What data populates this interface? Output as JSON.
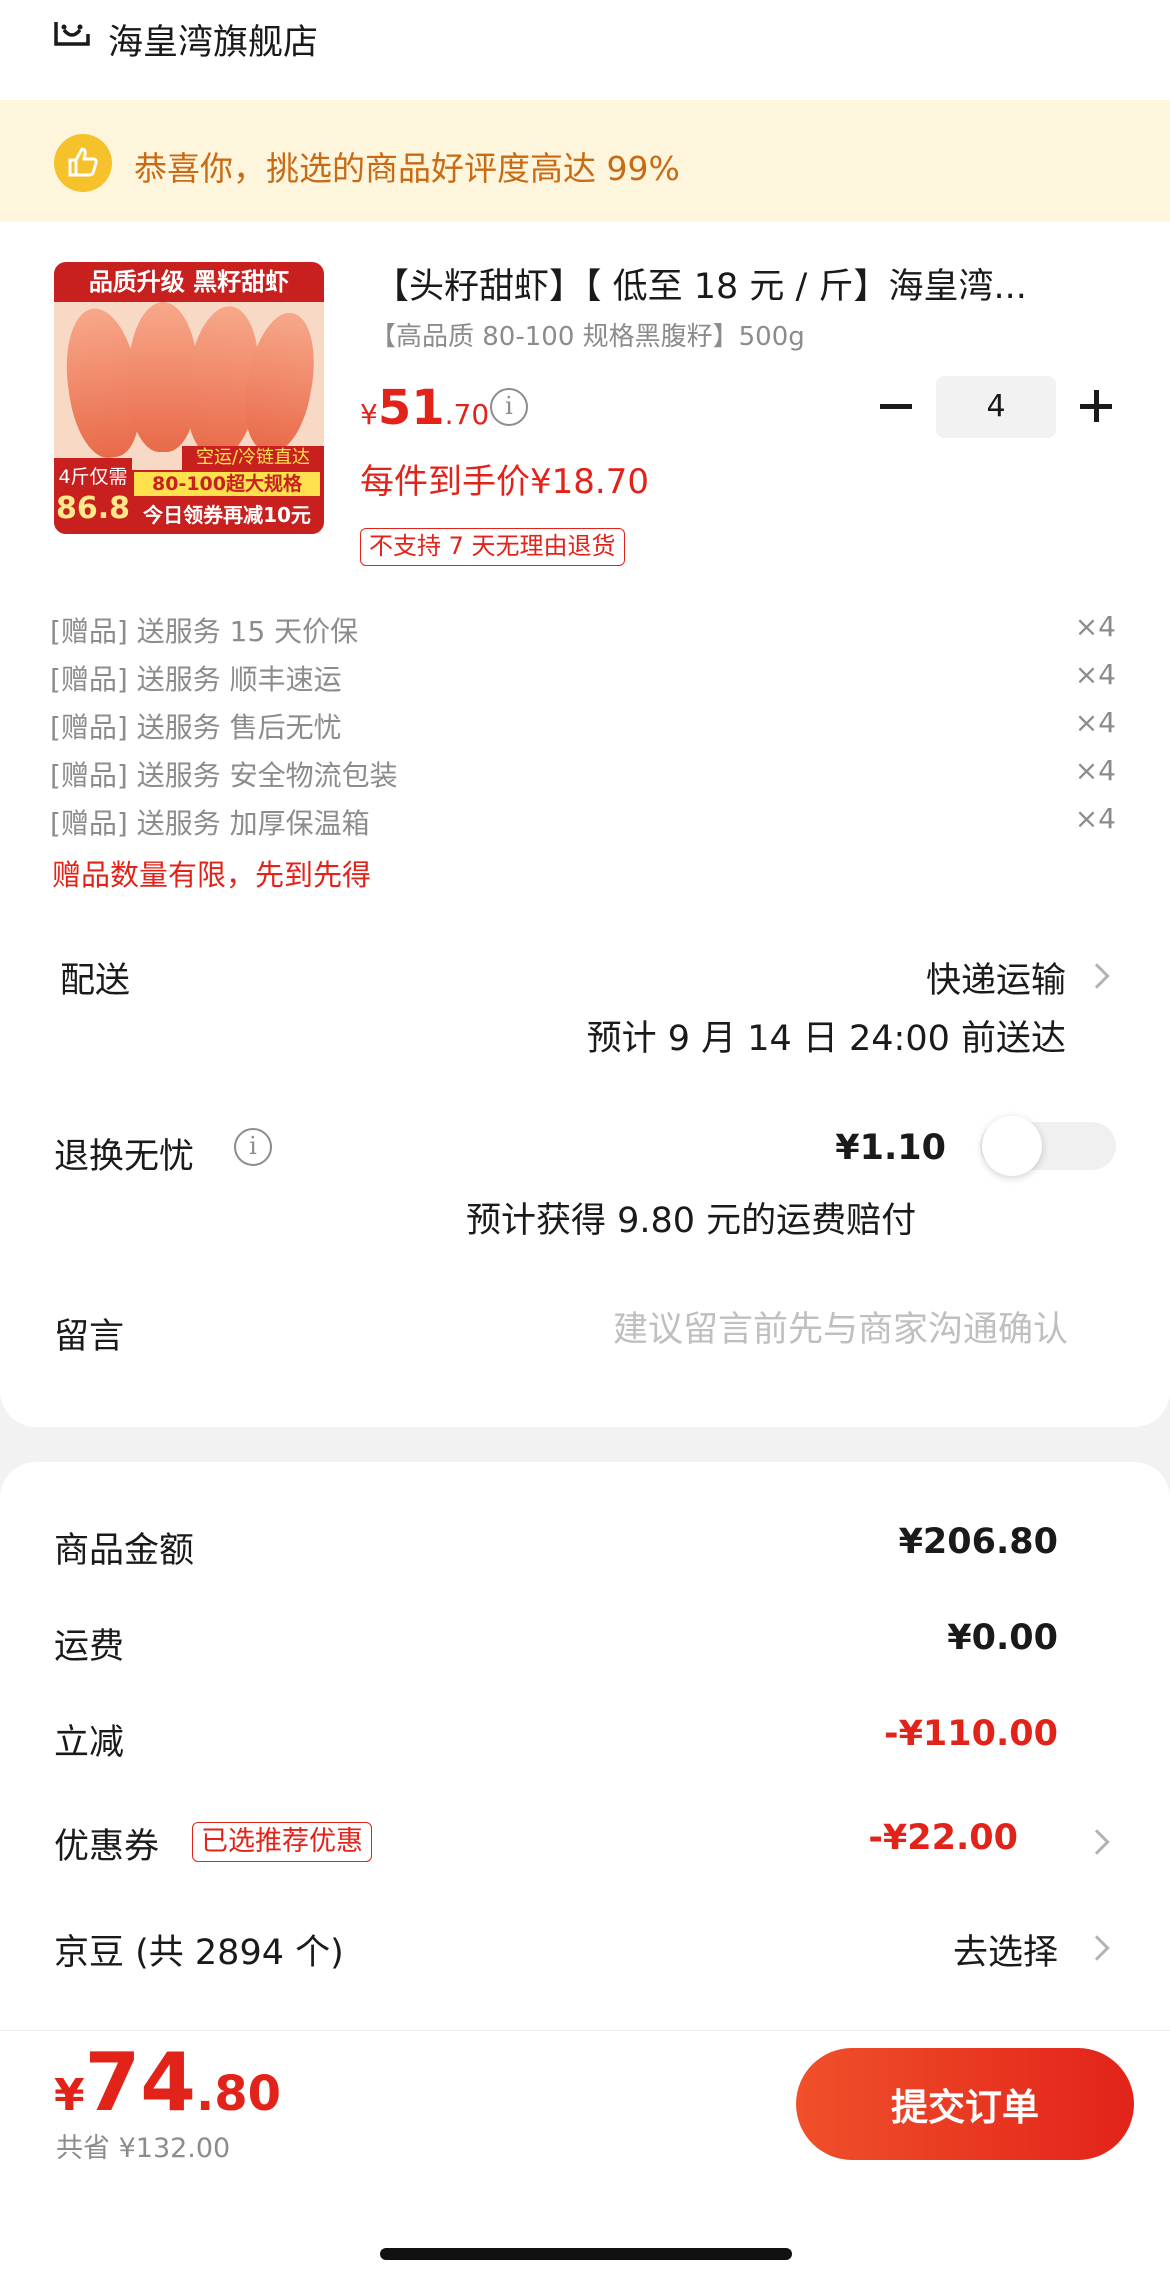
{
  "store": {
    "name": "海皇湾旗舰店"
  },
  "banner": {
    "text": "恭喜你，挑选的商品好评度高达 99%"
  },
  "product": {
    "title": "【头籽甜虾】【 低至 18 元 / 斤】海皇湾...",
    "spec": "【高品质 80-100 规格黑腹籽】500g",
    "price_currency": "¥",
    "price_int": "51",
    "price_dec": ".70",
    "per_item_price": "每件到手价¥18.70",
    "return_tag": "不支持 7 天无理由退货",
    "quantity": "4",
    "image_text": {
      "top": "品质升级 黑籽甜虾",
      "air": "空运/冷链直达",
      "size": "80-100超大规格",
      "side_tag": "4斤仅需",
      "side_price": "86.8",
      "coupon": "今日领券再减10元"
    }
  },
  "gifts": [
    {
      "label": "[赠品] 送服务 15 天价保",
      "qty": "×4"
    },
    {
      "label": "[赠品] 送服务 顺丰速运",
      "qty": "×4"
    },
    {
      "label": "[赠品] 送服务 售后无忧",
      "qty": "×4"
    },
    {
      "label": "[赠品] 送服务 安全物流包装",
      "qty": "×4"
    },
    {
      "label": "[赠品] 送服务 加厚保温箱",
      "qty": "×4"
    }
  ],
  "gift_note": "赠品数量有限，先到先得",
  "delivery": {
    "label": "配送",
    "method": "快递运输",
    "eta": "预计 9 月 14 日 24:00 前送达"
  },
  "insurance": {
    "label": "退换无忧",
    "price": "¥1.10",
    "note": "预计获得 9.80 元的运费赔付",
    "enabled": false
  },
  "message": {
    "label": "留言",
    "placeholder": "建议留言前先与商家沟通确认",
    "value": ""
  },
  "summary": {
    "goods_label": "商品金额",
    "goods_value": "¥206.80",
    "shipping_label": "运费",
    "shipping_value": "¥0.00",
    "discount_label": "立减",
    "discount_value": "-¥110.00",
    "coupon_label": "优惠券",
    "coupon_tag": "已选推荐优惠",
    "coupon_value": "-¥22.00",
    "beans_label": "京豆 (共 2894 个)",
    "beans_action": "去选择"
  },
  "footer": {
    "total_currency": "¥",
    "total_int": "74",
    "total_dec": ".80",
    "saved": "共省 ¥132.00",
    "submit_label": "提交订单"
  },
  "colors": {
    "accent": "#e2231a",
    "banner_bg": "#fdf6dc",
    "banner_text": "#c96a14"
  }
}
